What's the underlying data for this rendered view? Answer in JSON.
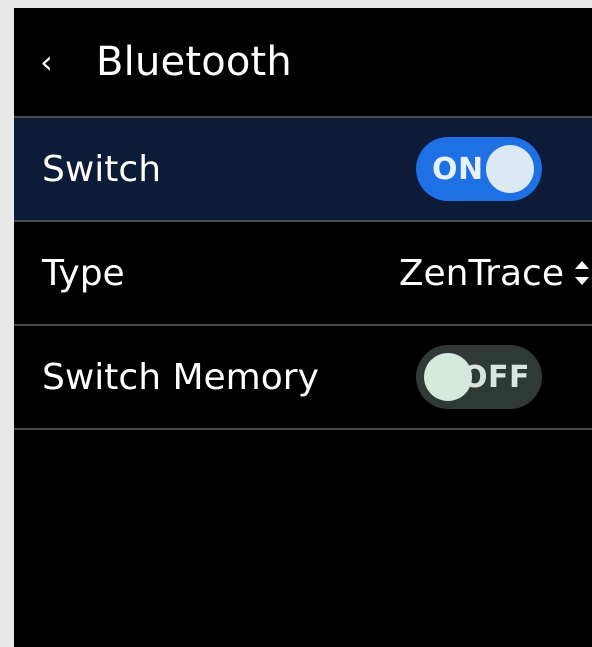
{
  "header": {
    "title": "Bluetooth",
    "back_icon": "chevron-left-icon"
  },
  "settings": {
    "switch": {
      "label": "Switch",
      "state": "ON",
      "enabled": true
    },
    "type": {
      "label": "Type",
      "value": "ZenTrace",
      "icon": "sort-icon"
    },
    "switch_memory": {
      "label": "Switch Memory",
      "state": "OFF",
      "enabled": false
    }
  },
  "colors": {
    "background": "#000000",
    "selected_row": "#0b1b38",
    "accent": "#1f6fe5",
    "off_toggle": "#2f3a36",
    "divider": "#4a4a4a"
  }
}
